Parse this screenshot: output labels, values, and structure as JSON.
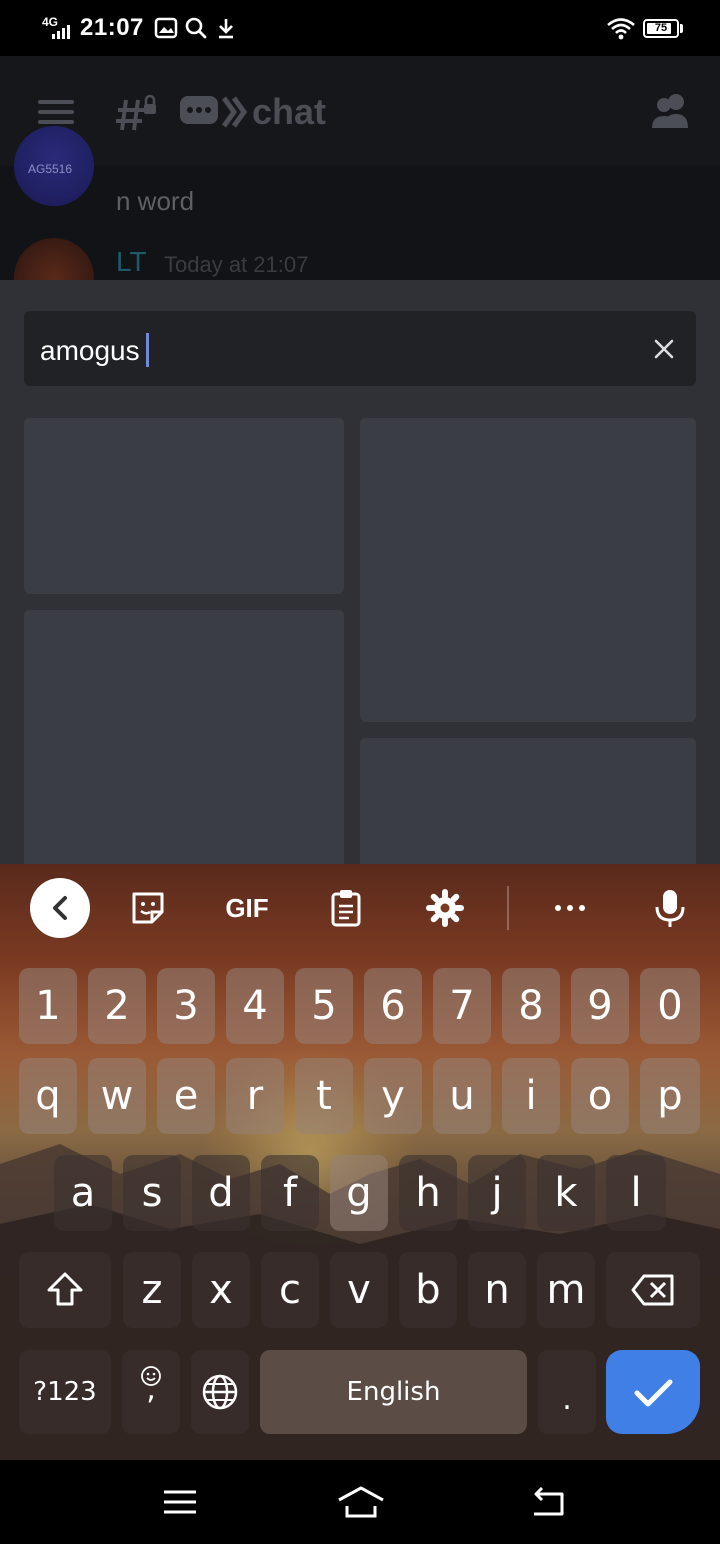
{
  "status_bar": {
    "network": "4G",
    "time": "21:07",
    "battery_level": "75",
    "icons": [
      "gallery-icon",
      "search-icon",
      "download-icon",
      "wifi-icon",
      "battery-icon"
    ]
  },
  "chat": {
    "channel_name": "chat",
    "avatar_label": "AG5516",
    "message_text": "n word",
    "author": "LT",
    "timestamp": "Today at 21:07"
  },
  "gif_search": {
    "query": "amogus"
  },
  "keyboard": {
    "toolbar": [
      "back-icon",
      "sticker-icon",
      "gif-button",
      "clipboard-icon",
      "settings-icon",
      "more-icon",
      "mic-icon"
    ],
    "gif_label": "GIF",
    "number_row": [
      "1",
      "2",
      "3",
      "4",
      "5",
      "6",
      "7",
      "8",
      "9",
      "0"
    ],
    "row1": [
      "q",
      "w",
      "e",
      "r",
      "t",
      "y",
      "u",
      "i",
      "o",
      "p"
    ],
    "row2": [
      "a",
      "s",
      "d",
      "f",
      "g",
      "h",
      "j",
      "k",
      "l"
    ],
    "row3": [
      "z",
      "x",
      "c",
      "v",
      "b",
      "n",
      "m"
    ],
    "symbols_label": "?123",
    "comma_label": ",",
    "space_label": "English",
    "period_label": "."
  },
  "colors": {
    "panel": "#2f3136",
    "search_bg": "#202225",
    "caret": "#7289da",
    "enter": "#3f7fe6"
  }
}
